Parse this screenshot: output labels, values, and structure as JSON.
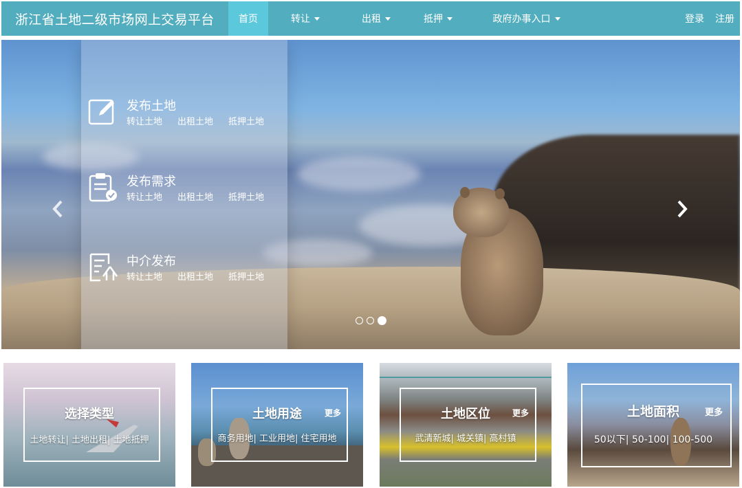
{
  "nav": {
    "brand": "浙江省土地二级市场网上交易平台",
    "items": [
      {
        "label": "首页",
        "dropdown": false,
        "active": true
      },
      {
        "label": "转让",
        "dropdown": true
      },
      {
        "label": "出租",
        "dropdown": true
      },
      {
        "label": "抵押",
        "dropdown": true
      },
      {
        "label": "政府办事入口",
        "dropdown": true
      }
    ],
    "login": "登录",
    "register": "注册"
  },
  "carousel": {
    "publish": [
      {
        "title": "发布土地",
        "icon": "edit-icon",
        "links": [
          "转让土地",
          "出租土地",
          "抵押土地"
        ]
      },
      {
        "title": "发布需求",
        "icon": "clipboard-check-icon",
        "links": [
          "转让土地",
          "出租土地",
          "抵押土地"
        ]
      },
      {
        "title": "中介发布",
        "icon": "document-agent-icon",
        "links": [
          "转让土地",
          "出租土地",
          "抵押土地"
        ]
      }
    ],
    "slides": 3,
    "active_slide": 3
  },
  "cards": [
    {
      "title": "选择类型",
      "more": "",
      "links": "土地转让| 土地出租| 土地抵押"
    },
    {
      "title": "土地用途",
      "more": "更多",
      "links": "商务用地| 工业用地| 住宅用地"
    },
    {
      "title": "土地区位",
      "more": "更多",
      "links": "武清新城| 城关镇| 高村镇"
    },
    {
      "title": "土地面积",
      "more": "更多",
      "links": "50以下| 50-100| 100-500"
    }
  ],
  "colors": {
    "navbar": "#52aebf",
    "nav_active": "#5bc8dc"
  }
}
